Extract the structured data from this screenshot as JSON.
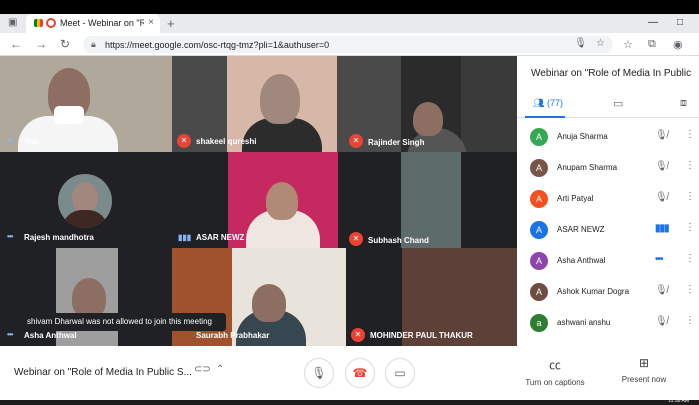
{
  "browser": {
    "tab_title": "Meet - Webinar on \"Role of",
    "tab_close": "×",
    "new_tab": "+",
    "url": "https://meet.google.com/osc-rtqg-tmz?pli=1&authuser=0",
    "window_min": "—",
    "window_max": "□"
  },
  "tiles": [
    {
      "name": "You",
      "status": "dots"
    },
    {
      "name": "shakeel qureshi",
      "status": "muted"
    },
    {
      "name": "Rajinder Singh",
      "status": "muted"
    },
    {
      "name": "Rajesh mandhotra",
      "status": "dots"
    },
    {
      "name": "ASAR NEWZ",
      "status": "speaking"
    },
    {
      "name": "Subhash Chand",
      "status": "muted"
    },
    {
      "name": "Asha Anthwal",
      "status": "dots"
    },
    {
      "name": "Saurabh Prabhakar",
      "status": "none"
    },
    {
      "name": "MOHINDER PAUL THAKUR",
      "status": "muted"
    }
  ],
  "toast": "shivam Dharwal was not allowed to join this meeting",
  "sidebar": {
    "title": "Webinar on \"Role of Media In Public S...",
    "people_count": "(77)",
    "participants": [
      {
        "name": "Anuja Sharma",
        "initial": "A",
        "color": "#34a853",
        "status": "muted"
      },
      {
        "name": "Anupam Sharma",
        "initial": "A",
        "color": "#795548",
        "status": "muted"
      },
      {
        "name": "Arti Patyal",
        "initial": "A",
        "color": "#f4511e",
        "status": "muted"
      },
      {
        "name": "ASAR NEWZ",
        "initial": "A",
        "color": "#1a73e8",
        "status": "speaking"
      },
      {
        "name": "Asha Anthwal",
        "initial": "A",
        "color": "#8e44ad",
        "status": "dots"
      },
      {
        "name": "Ashok Kumar Dogra",
        "initial": "A",
        "color": "#6d4c41",
        "status": "muted"
      },
      {
        "name": "ashwani anshu",
        "initial": "a",
        "color": "#2e7d32",
        "status": "muted"
      }
    ]
  },
  "bottom": {
    "meeting_title": "Webinar on \"Role of Media In Public S...",
    "captions": "Turn on captions",
    "present": "Present now"
  },
  "clock": "11:58 AM"
}
